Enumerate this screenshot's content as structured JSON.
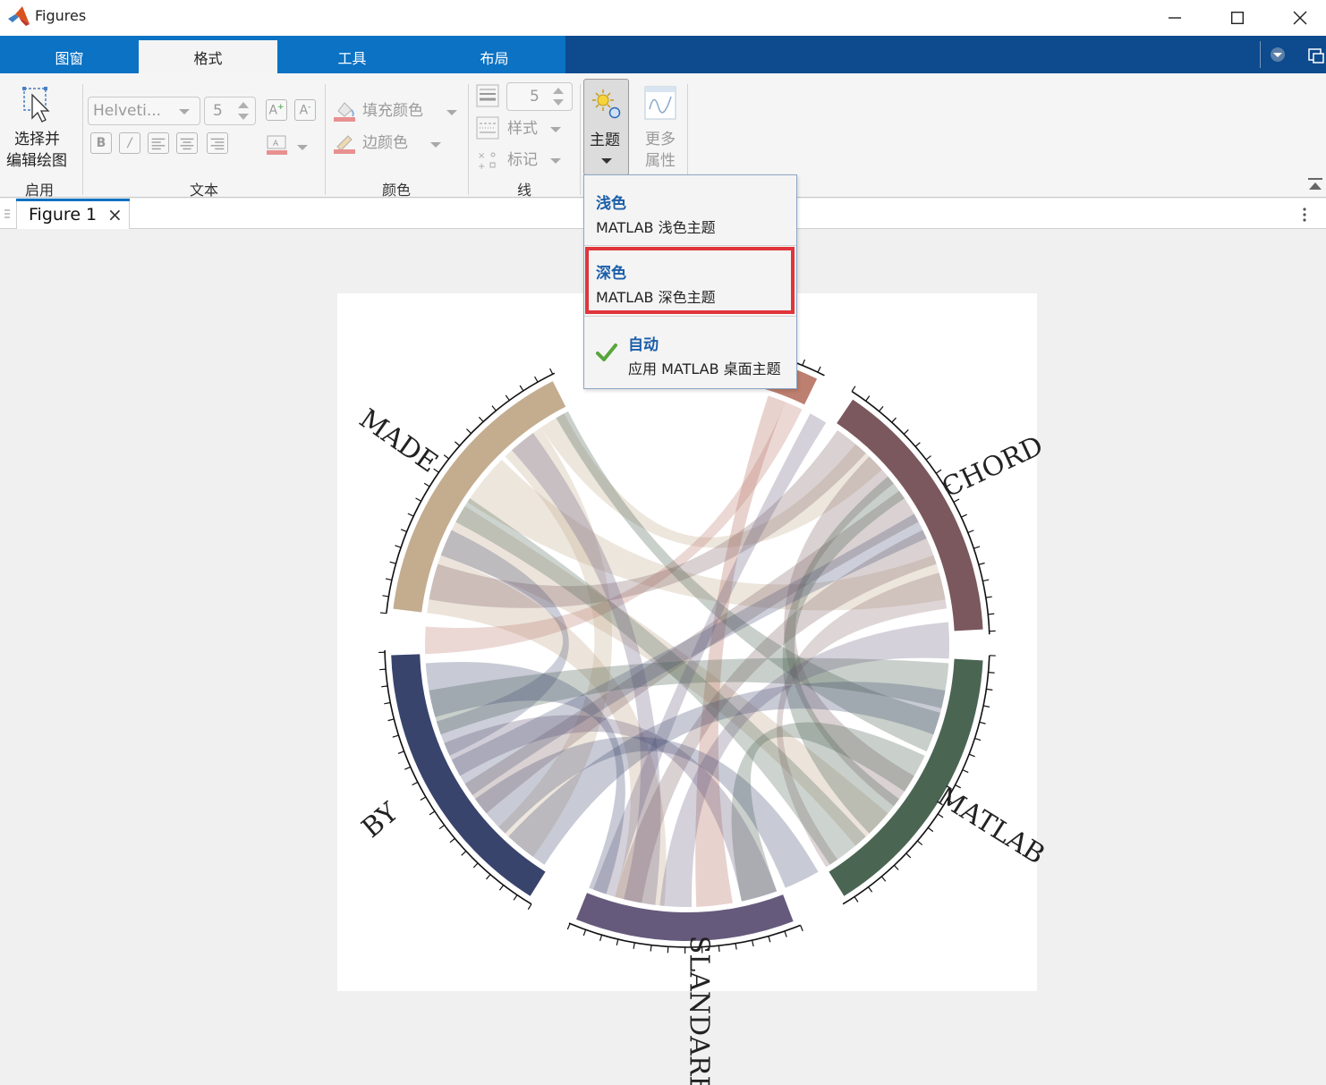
{
  "window": {
    "title": "Figures",
    "icon": "matlab-logo-icon"
  },
  "tabs": [
    {
      "label": "图窗",
      "active": false
    },
    {
      "label": "格式",
      "active": true
    },
    {
      "label": "工具",
      "active": false
    },
    {
      "label": "布局",
      "active": false
    }
  ],
  "ribbon": {
    "enable": {
      "select_edit_line1": "选择并",
      "select_edit_line2": "编辑绘图",
      "group_label": "启用"
    },
    "text": {
      "font_name": "Helveti...",
      "font_size": "5",
      "group_label": "文本"
    },
    "color": {
      "fill_color": "填充颜色",
      "edge_color": "边颜色",
      "group_label": "颜色"
    },
    "line": {
      "line_width": "5",
      "style": "样式",
      "marker": "标记",
      "group_label": "线"
    },
    "theme": {
      "label": "主题"
    },
    "more": {
      "line1": "更多",
      "line2": "属性"
    }
  },
  "theme_menu": {
    "items": [
      {
        "title": "浅色",
        "desc": "MATLAB 浅色主题",
        "checked": false
      },
      {
        "title": "深色",
        "desc": "MATLAB 深色主题",
        "checked": false
      },
      {
        "title": "自动",
        "desc": "应用 MATLAB 桌面主题",
        "checked": true
      }
    ],
    "highlight_color": "#e0343a"
  },
  "document_tab": {
    "label": "Figure 1"
  },
  "chart_data": {
    "type": "chord",
    "categories": [
      "MADE",
      "CHORD",
      "MATLAB",
      "SLANDARER",
      "BY"
    ],
    "colors": {
      "MADE": "#c4ac8f",
      "TOP": "#bd7f6f",
      "CHORD": "#7b585d",
      "MATLAB": "#4b6553",
      "SLANDARER": "#665a7c",
      "BY": "#39446d"
    }
  }
}
